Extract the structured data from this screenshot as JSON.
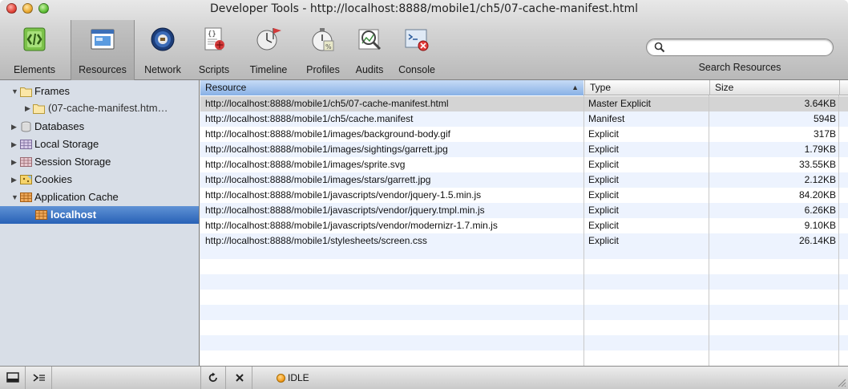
{
  "window": {
    "title": "Developer Tools - http://localhost:8888/mobile1/ch5/07-cache-manifest.html"
  },
  "toolbar": {
    "items": [
      {
        "label": "Elements",
        "icon": "elements-icon"
      },
      {
        "label": "Resources",
        "icon": "resources-icon"
      },
      {
        "label": "Network",
        "icon": "network-icon"
      },
      {
        "label": "Scripts",
        "icon": "scripts-icon"
      },
      {
        "label": "Timeline",
        "icon": "timeline-icon"
      },
      {
        "label": "Profiles",
        "icon": "profiles-icon"
      },
      {
        "label": "Audits",
        "icon": "audits-icon"
      },
      {
        "label": "Console",
        "icon": "console-icon"
      }
    ],
    "active": "Resources",
    "search": {
      "placeholder": "",
      "value": "",
      "caption": "Search Resources"
    }
  },
  "sidebar": {
    "items": [
      {
        "label": "Frames",
        "icon": "folder-icon",
        "expanded": true
      },
      {
        "label": "(07-cache-manifest.htm…",
        "icon": "folder-icon",
        "expanded": false
      },
      {
        "label": "Databases",
        "icon": "database-icon",
        "expanded": false
      },
      {
        "label": "Local Storage",
        "icon": "storage-grid-icon",
        "expanded": false
      },
      {
        "label": "Session Storage",
        "icon": "storage-grid-icon",
        "expanded": false
      },
      {
        "label": "Cookies",
        "icon": "cookie-icon",
        "expanded": false
      },
      {
        "label": "Application Cache",
        "icon": "app-cache-icon",
        "expanded": true
      },
      {
        "label": "localhost",
        "icon": "app-cache-icon",
        "selected": true
      }
    ]
  },
  "table": {
    "columns": [
      "Resource",
      "Type",
      "Size"
    ],
    "sorted_column": "Resource",
    "rows": [
      {
        "resource": "http://localhost:8888/mobile1/ch5/07-cache-manifest.html",
        "type": "Master Explicit",
        "size": "3.64KB"
      },
      {
        "resource": "http://localhost:8888/mobile1/ch5/cache.manifest",
        "type": "Manifest",
        "size": "594B"
      },
      {
        "resource": "http://localhost:8888/mobile1/images/background-body.gif",
        "type": "Explicit",
        "size": "317B"
      },
      {
        "resource": "http://localhost:8888/mobile1/images/sightings/garrett.jpg",
        "type": "Explicit",
        "size": "1.79KB"
      },
      {
        "resource": "http://localhost:8888/mobile1/images/sprite.svg",
        "type": "Explicit",
        "size": "33.55KB"
      },
      {
        "resource": "http://localhost:8888/mobile1/images/stars/garrett.jpg",
        "type": "Explicit",
        "size": "2.12KB"
      },
      {
        "resource": "http://localhost:8888/mobile1/javascripts/vendor/jquery-1.5.min.js",
        "type": "Explicit",
        "size": "84.20KB"
      },
      {
        "resource": "http://localhost:8888/mobile1/javascripts/vendor/jquery.tmpl.min.js",
        "type": "Explicit",
        "size": "6.26KB"
      },
      {
        "resource": "http://localhost:8888/mobile1/javascripts/vendor/modernizr-1.7.min.js",
        "type": "Explicit",
        "size": "9.10KB"
      },
      {
        "resource": "http://localhost:8888/mobile1/stylesheets/screen.css",
        "type": "Explicit",
        "size": "26.14KB"
      }
    ]
  },
  "statusbar": {
    "dock_icon": "dock-icon",
    "console_icon": "console-prompt-icon",
    "refresh_icon": "refresh-icon",
    "delete_icon": "delete-icon",
    "status_text": "IDLE",
    "status_color": "#f39a1a"
  }
}
